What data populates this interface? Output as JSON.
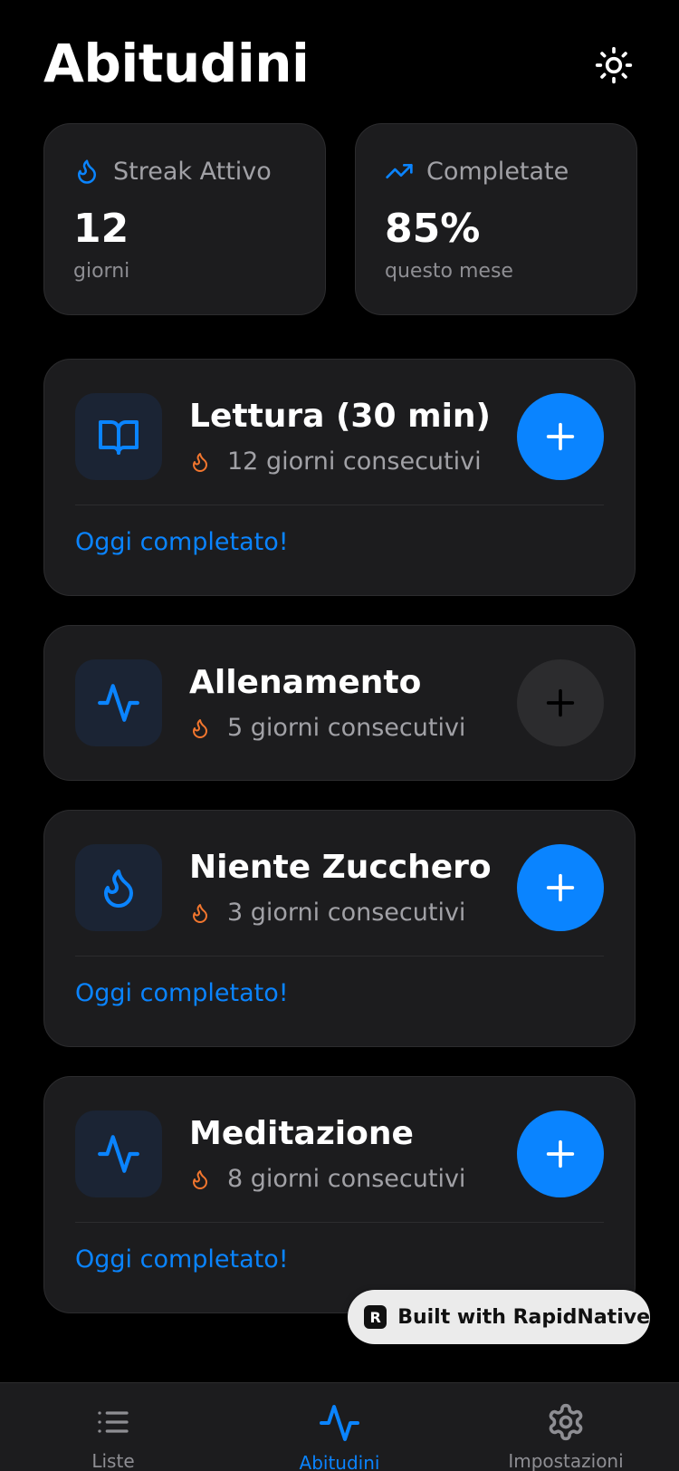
{
  "header": {
    "title": "Abitudini",
    "theme_icon": "sun-icon"
  },
  "stats": [
    {
      "icon": "flame-icon",
      "label": "Streak Attivo",
      "value": "12",
      "sub": "giorni"
    },
    {
      "icon": "trending-up-icon",
      "label": "Completate",
      "value": "85%",
      "sub": "questo mese"
    }
  ],
  "habits": [
    {
      "name": "Lettura (30 min)",
      "icon": "book-open-icon",
      "streak": "12 giorni consecutivi",
      "completed": true,
      "status": "Oggi completato!"
    },
    {
      "name": "Allenamento",
      "icon": "activity-icon",
      "streak": "5 giorni consecutivi",
      "completed": false,
      "status": ""
    },
    {
      "name": "Niente Zucchero",
      "icon": "flame-icon",
      "streak": "3 giorni consecutivi",
      "completed": true,
      "status": "Oggi completato!"
    },
    {
      "name": "Meditazione",
      "icon": "activity-icon",
      "streak": "8 giorni consecutivi",
      "completed": true,
      "status": "Oggi completato!"
    }
  ],
  "badge": {
    "text": "Built with RapidNative",
    "logo": "R"
  },
  "tabs": [
    {
      "label": "Liste",
      "icon": "list-icon",
      "active": false
    },
    {
      "label": "Abitudini",
      "icon": "activity-icon",
      "active": true
    },
    {
      "label": "Impostazioni",
      "icon": "gear-icon",
      "active": false
    }
  ],
  "colors": {
    "accent": "#0a84ff",
    "flame": "#f2762e",
    "card": "#1c1c1e",
    "background": "#000000"
  }
}
